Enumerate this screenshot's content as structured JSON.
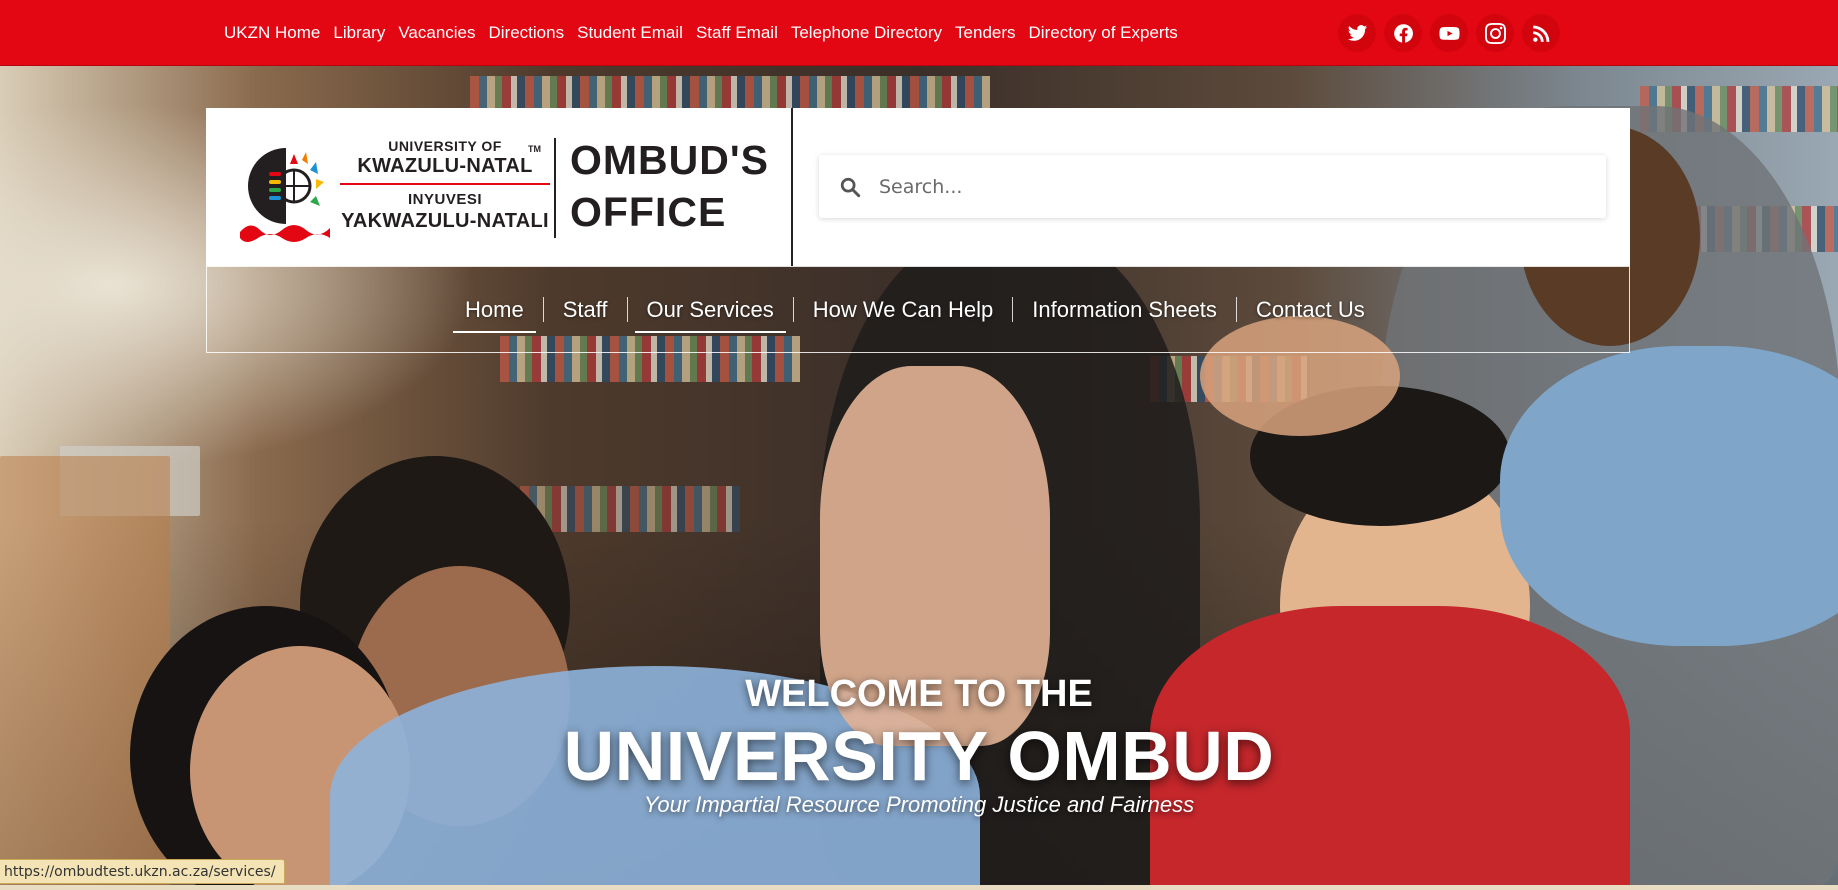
{
  "topbar": {
    "links": [
      "UKZN Home",
      "Library",
      "Vacancies",
      "Directions",
      "Student Email",
      "Staff Email",
      "Telephone Directory",
      "Tenders",
      "Directory of Experts"
    ],
    "socials": [
      "twitter-icon",
      "facebook-icon",
      "youtube-icon",
      "instagram-icon",
      "rss-icon"
    ],
    "color": "#e30613"
  },
  "logo": {
    "line1": "UNIVERSITY OF",
    "line2": "KWAZULU-NATAL",
    "line3": "INYUVESI",
    "line4": "YAKWAZULU-NATALI",
    "tm": "TM"
  },
  "office_title": {
    "line1": "OMBUD'S",
    "line2": "OFFICE"
  },
  "search": {
    "placeholder": "Search..."
  },
  "nav": {
    "items": [
      "Home",
      "Staff",
      "Our Services",
      "How We Can Help",
      "Information Sheets",
      "Contact Us"
    ],
    "active": "Home",
    "hovered": "Our Services"
  },
  "hero": {
    "welcome": "WELCOME TO THE",
    "title": "UNIVERSITY OMBUD",
    "tagline": "Your Impartial Resource Promoting Justice and Fairness"
  },
  "status": {
    "url": "https://ombudtest.ukzn.ac.za/services/"
  }
}
